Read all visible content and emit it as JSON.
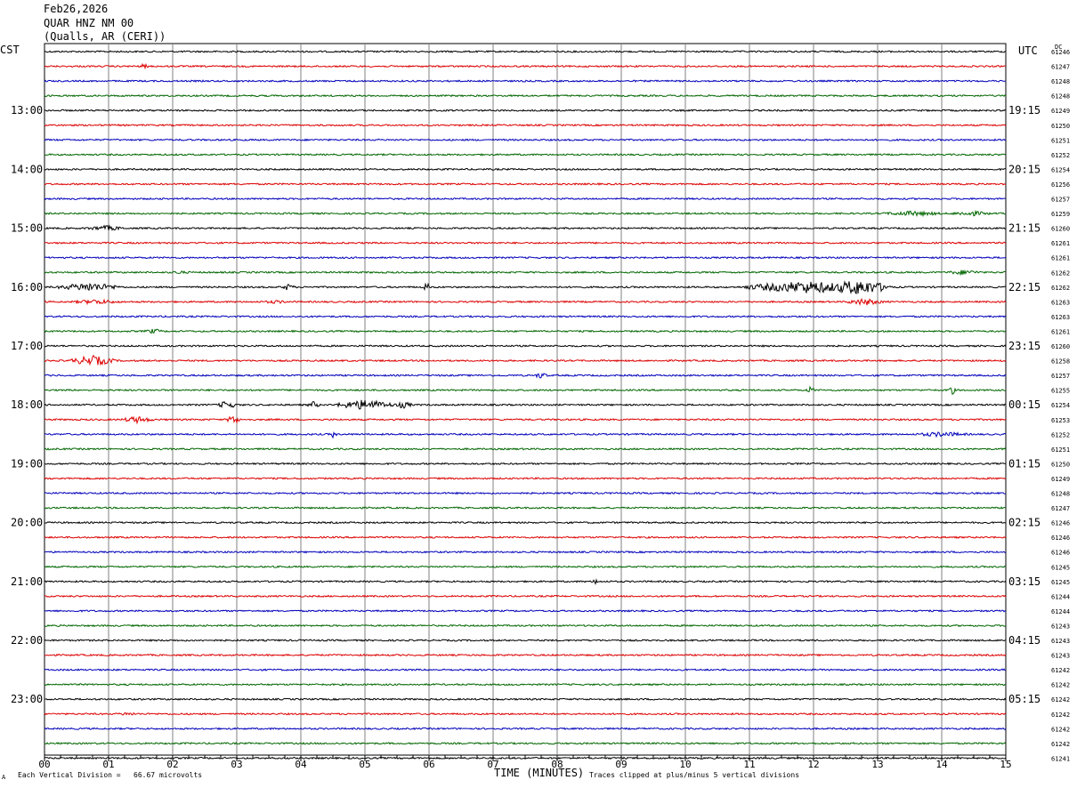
{
  "header": {
    "date": "Feb26,2026",
    "station": "QUAR HNZ NM 00",
    "location": "(Qualls, AR (CERI))"
  },
  "left_tz": "CST",
  "right_tz": "UTC",
  "dc_label": "DC",
  "footer": {
    "scale_note": "Each Vertical Division =   66.67 microvolts",
    "clip_note": "Traces clipped at plus/minus 5 vertical divisions",
    "corner_mark": "A"
  },
  "colors": {
    "trace_cycle": [
      "#000000",
      "#dd0000",
      "#0000bb",
      "#006600"
    ],
    "grid": "#808080"
  },
  "chart_data": {
    "type": "line",
    "title": "QUAR HNZ NM 00",
    "xlabel": "TIME (MINUTES)",
    "ylabel": "",
    "xlim": [
      0,
      15
    ],
    "x_ticks": [
      "00",
      "01",
      "02",
      "03",
      "04",
      "05",
      "06",
      "07",
      "08",
      "09",
      "10",
      "11",
      "12",
      "13",
      "14",
      "15"
    ],
    "rows_per_hour": 4,
    "minutes_per_row": 15,
    "left_hour_labels": [
      "13:00",
      "14:00",
      "15:00",
      "16:00",
      "17:00",
      "18:00",
      "19:00",
      "20:00",
      "21:00",
      "22:00",
      "23:00"
    ],
    "right_hour_labels": [
      "19:15",
      "20:15",
      "21:15",
      "22:15",
      "23:15",
      "00:15",
      "01:15",
      "02:15",
      "03:15",
      "04:15",
      "05:15"
    ],
    "first_labeled_row": 4,
    "dc_offsets": [
      "61246",
      "61247",
      "61248",
      "61248",
      "61249",
      "61250",
      "61251",
      "61252",
      "61254",
      "61256",
      "61257",
      "61259",
      "61260",
      "61261",
      "61261",
      "61262",
      "61262",
      "61263",
      "61263",
      "61261",
      "61260",
      "61258",
      "61257",
      "61255",
      "61254",
      "61253",
      "61252",
      "61251",
      "61250",
      "61249",
      "61248",
      "61247",
      "61246",
      "61246",
      "61246",
      "61245",
      "61245",
      "61244",
      "61244",
      "61243",
      "61243",
      "61243",
      "61242",
      "61242",
      "61242",
      "61242",
      "61242",
      "61242",
      "61241"
    ],
    "events": [
      {
        "row": 1,
        "minute": 1.55,
        "width": 0.08,
        "amp": 3
      },
      {
        "row": 11,
        "minute": 13.55,
        "width": 0.5,
        "amp": 3
      },
      {
        "row": 11,
        "minute": 14.45,
        "width": 0.35,
        "amp": 3
      },
      {
        "row": 12,
        "minute": 0.95,
        "width": 0.35,
        "amp": 3
      },
      {
        "row": 15,
        "minute": 2.1,
        "width": 0.2,
        "amp": 2
      },
      {
        "row": 15,
        "minute": 14.35,
        "width": 0.3,
        "amp": 3
      },
      {
        "row": 16,
        "minute": 0.7,
        "width": 0.5,
        "amp": 5
      },
      {
        "row": 16,
        "minute": 3.8,
        "width": 0.1,
        "amp": 4
      },
      {
        "row": 16,
        "minute": 5.95,
        "width": 0.06,
        "amp": 6
      },
      {
        "row": 16,
        "minute": 11.9,
        "width": 1.0,
        "amp": 7
      },
      {
        "row": 16,
        "minute": 12.7,
        "width": 0.5,
        "amp": 9
      },
      {
        "row": 17,
        "minute": 0.8,
        "width": 0.4,
        "amp": 3
      },
      {
        "row": 17,
        "minute": 12.8,
        "width": 0.3,
        "amp": 4
      },
      {
        "row": 17,
        "minute": 3.6,
        "width": 0.3,
        "amp": 2
      },
      {
        "row": 19,
        "minute": 1.7,
        "width": 0.15,
        "amp": 3
      },
      {
        "row": 21,
        "minute": 0.75,
        "width": 0.35,
        "amp": 6
      },
      {
        "row": 22,
        "minute": 7.75,
        "width": 0.1,
        "amp": 4
      },
      {
        "row": 23,
        "minute": 11.95,
        "width": 0.06,
        "amp": 5
      },
      {
        "row": 23,
        "minute": 14.15,
        "width": 0.06,
        "amp": 6
      },
      {
        "row": 24,
        "minute": 2.85,
        "width": 0.15,
        "amp": 5
      },
      {
        "row": 24,
        "minute": 4.2,
        "width": 0.1,
        "amp": 4
      },
      {
        "row": 24,
        "minute": 5.0,
        "width": 0.45,
        "amp": 6
      },
      {
        "row": 24,
        "minute": 5.6,
        "width": 0.15,
        "amp": 4
      },
      {
        "row": 25,
        "minute": 1.45,
        "width": 0.25,
        "amp": 4
      },
      {
        "row": 25,
        "minute": 2.95,
        "width": 0.1,
        "amp": 6
      },
      {
        "row": 26,
        "minute": 4.5,
        "width": 0.06,
        "amp": 4
      },
      {
        "row": 26,
        "minute": 14.0,
        "width": 0.45,
        "amp": 3
      },
      {
        "row": 36,
        "minute": 8.6,
        "width": 0.05,
        "amp": 4
      },
      {
        "row": 45,
        "minute": 1.3,
        "width": 0.25,
        "amp": 2
      }
    ]
  }
}
